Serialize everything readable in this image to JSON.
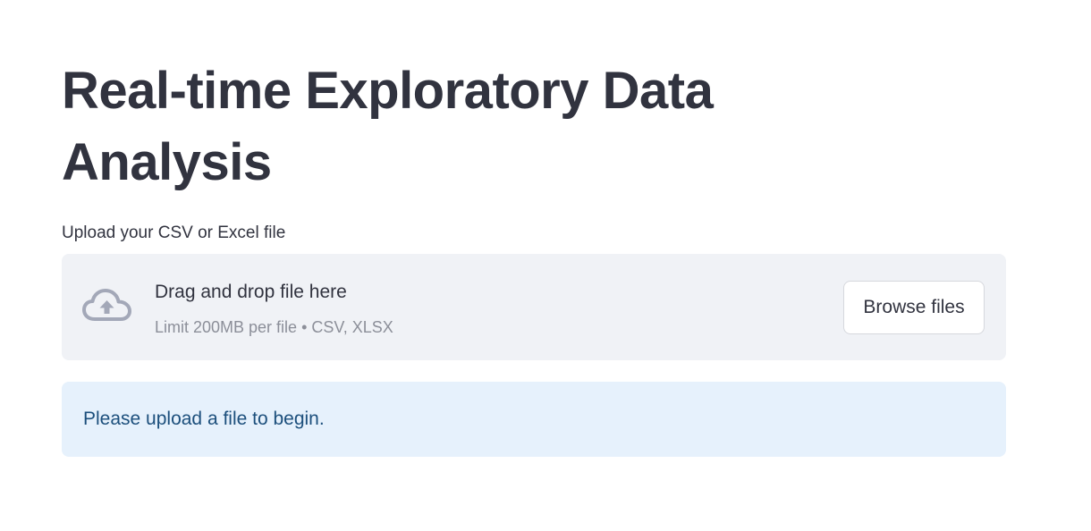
{
  "page": {
    "title": "Real-time Exploratory Data Analysis"
  },
  "uploader": {
    "label": "Upload your CSV or Excel file",
    "icon": "cloud-upload-icon",
    "dropzone_title": "Drag and drop file here",
    "dropzone_subtitle": "Limit 200MB per file • CSV, XLSX",
    "browse_label": "Browse files"
  },
  "info": {
    "message": "Please upload a file to begin."
  },
  "colors": {
    "text": "#31333f",
    "dropzone_bg": "#f0f2f6",
    "info_bg": "#e6f1fc",
    "info_text": "#1c4f7c",
    "icon": "#a3a8b8"
  }
}
